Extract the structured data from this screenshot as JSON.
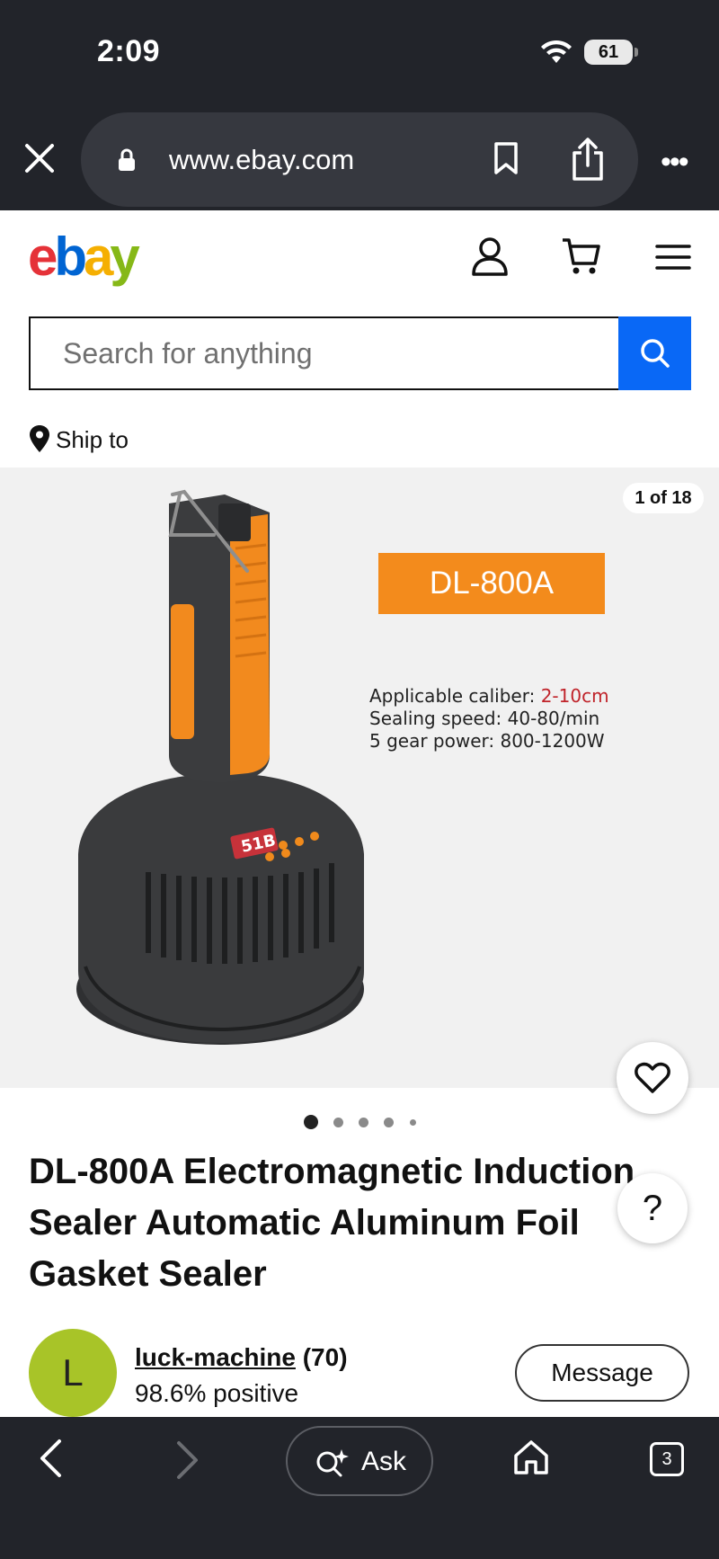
{
  "status_bar": {
    "time": "2:09",
    "battery": "61"
  },
  "browser": {
    "url": "www.ebay.com"
  },
  "header": {
    "logo": {
      "e": "e",
      "b": "b",
      "a": "a",
      "y": "y"
    }
  },
  "search": {
    "placeholder": "Search for anything"
  },
  "ship_to": {
    "label": "Ship to"
  },
  "gallery": {
    "counter": "1 of 18",
    "model_badge": "DL-800A",
    "spec_caliber_label": "Applicable caliber: ",
    "spec_caliber_value": "2-10cm",
    "spec_speed": "Sealing speed: 40-80/min",
    "spec_power": "5 gear power: 800-1200W",
    "device_display": "51B",
    "dots_count": 5,
    "active_dot": 1
  },
  "listing": {
    "title": "DL-800A Electromagnetic Induction Sealer Automatic Aluminum Foil Gasket Sealer"
  },
  "help": {
    "label": "?"
  },
  "seller": {
    "avatar_letter": "L",
    "name": "luck-machine",
    "feedback_count": "(70)",
    "positive": "98.6% positive",
    "message_label": "Message"
  },
  "toolbar": {
    "ask_label": "Ask",
    "tab_count": "3"
  },
  "colors": {
    "ebay_blue": "#0968f6",
    "badge_orange": "#f38b1c",
    "avatar_green": "#a8c428",
    "chrome_dark": "#22242a"
  }
}
